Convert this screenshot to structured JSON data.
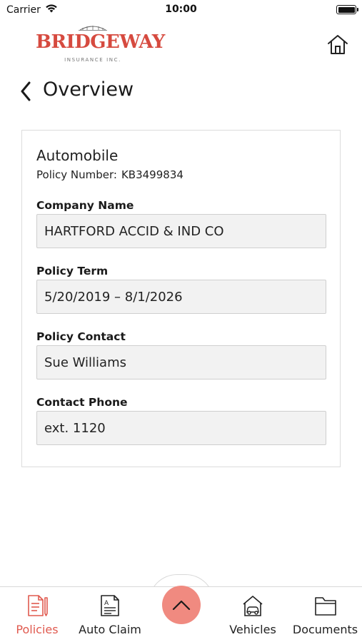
{
  "status_bar": {
    "carrier": "Carrier",
    "time": "10:00",
    "icons": [
      "wifi-icon",
      "battery-icon"
    ]
  },
  "header": {
    "logo_text": "BRIDGEWAY",
    "logo_subtext": "INSURANCE INC.",
    "home_icon": "home-icon"
  },
  "title_bar": {
    "back_icon": "chevron-left-icon",
    "title": "Overview"
  },
  "policy": {
    "type": "Automobile",
    "number_label": "Policy Number:",
    "number_value": "KB3499834",
    "fields": [
      {
        "label": "Company Name",
        "value": "HARTFORD ACCID & IND CO"
      },
      {
        "label": "Policy Term",
        "value": "5/20/2019 – 8/1/2026"
      },
      {
        "label": "Policy Contact",
        "value": "Sue Williams"
      },
      {
        "label": "Contact Phone",
        "value": "ext. 1120"
      }
    ]
  },
  "bottom_nav": {
    "items": [
      {
        "label": "Policies",
        "icon": "policies-icon",
        "active": true
      },
      {
        "label": "Auto Claim",
        "icon": "auto-claim-icon",
        "active": false
      },
      {
        "label": "Vehicles",
        "icon": "vehicles-icon",
        "active": false
      },
      {
        "label": "Documents",
        "icon": "documents-icon",
        "active": false
      }
    ],
    "center_button_icon": "chevron-up-icon"
  },
  "colors": {
    "brand_red": "#d64a3f",
    "active_nav": "#e05a4f",
    "fab": "#f08a80",
    "field_bg": "#f2f2f2"
  }
}
